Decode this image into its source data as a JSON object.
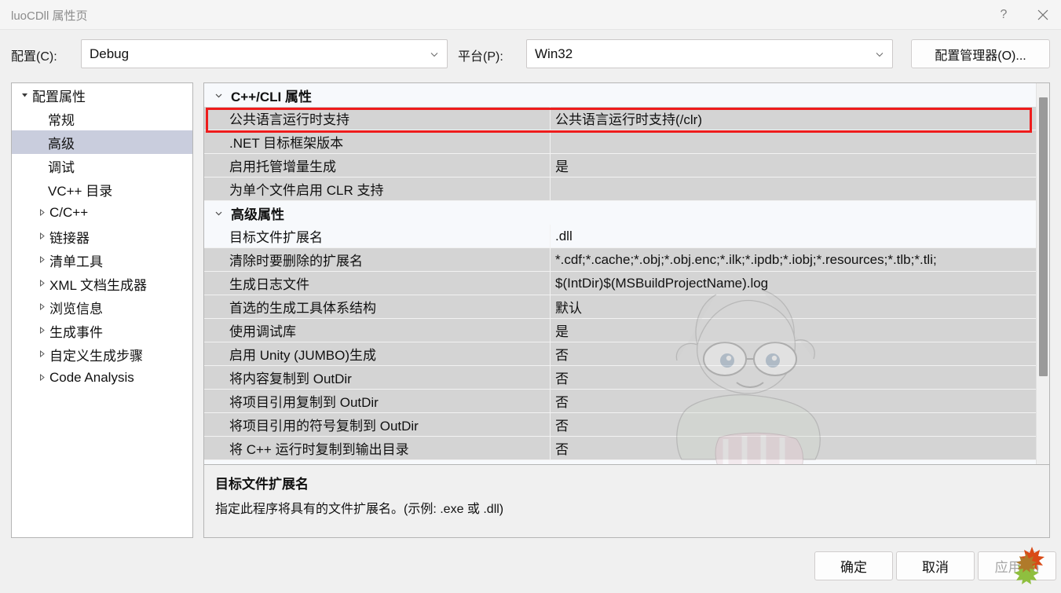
{
  "window": {
    "title": "luoCDll 属性页",
    "help_icon": "question-mark-icon",
    "close_icon": "close-icon"
  },
  "toolbar": {
    "config_label": "配置(C):",
    "config_value": "Debug",
    "platform_label": "平台(P):",
    "platform_value": "Win32",
    "config_manager_label": "配置管理器(O)...",
    "dropdown_icon": "chevron-down-icon"
  },
  "tree": {
    "items": [
      {
        "label": "配置属性",
        "level": 0,
        "expander": "triangle-down",
        "selected": false
      },
      {
        "label": "常规",
        "level": 1,
        "expander": "",
        "selected": false
      },
      {
        "label": "高级",
        "level": 1,
        "expander": "",
        "selected": true
      },
      {
        "label": "调试",
        "level": 1,
        "expander": "",
        "selected": false
      },
      {
        "label": "VC++ 目录",
        "level": 1,
        "expander": "",
        "selected": false
      },
      {
        "label": "C/C++",
        "level": 1,
        "expander": "triangle-right",
        "selected": false
      },
      {
        "label": "链接器",
        "level": 1,
        "expander": "triangle-right",
        "selected": false
      },
      {
        "label": "清单工具",
        "level": 1,
        "expander": "triangle-right",
        "selected": false
      },
      {
        "label": "XML 文档生成器",
        "level": 1,
        "expander": "triangle-right",
        "selected": false
      },
      {
        "label": "浏览信息",
        "level": 1,
        "expander": "triangle-right",
        "selected": false
      },
      {
        "label": "生成事件",
        "level": 1,
        "expander": "triangle-right",
        "selected": false
      },
      {
        "label": "自定义生成步骤",
        "level": 1,
        "expander": "triangle-right",
        "selected": false
      },
      {
        "label": "Code Analysis",
        "level": 1,
        "expander": "triangle-right",
        "selected": false
      }
    ]
  },
  "grid": {
    "sections": [
      {
        "title": "C++/CLI 属性",
        "collapse_icon": "chevron-down-icon",
        "rows": [
          {
            "name": "公共语言运行时支持",
            "value": "公共语言运行时支持(/clr)",
            "highlighted": true
          },
          {
            "name": ".NET 目标框架版本",
            "value": "",
            "highlighted": false
          },
          {
            "name": "启用托管增量生成",
            "value": "是",
            "highlighted": false
          },
          {
            "name": "为单个文件启用 CLR 支持",
            "value": "",
            "highlighted": false
          }
        ]
      },
      {
        "title": "高级属性",
        "collapse_icon": "chevron-down-icon",
        "rows": [
          {
            "name": "目标文件扩展名",
            "value": ".dll",
            "highlighted": false
          },
          {
            "name": "清除时要删除的扩展名",
            "value": "*.cdf;*.cache;*.obj;*.obj.enc;*.ilk;*.ipdb;*.iobj;*.resources;*.tlb;*.tli;",
            "highlighted": false
          },
          {
            "name": "生成日志文件",
            "value": "$(IntDir)$(MSBuildProjectName).log",
            "highlighted": false
          },
          {
            "name": "首选的生成工具体系结构",
            "value": "默认",
            "highlighted": false
          },
          {
            "name": "使用调试库",
            "value": "是",
            "highlighted": false
          },
          {
            "name": "启用 Unity (JUMBO)生成",
            "value": "否",
            "highlighted": false
          },
          {
            "name": "将内容复制到 OutDir",
            "value": "否",
            "highlighted": false
          },
          {
            "name": "将项目引用复制到 OutDir",
            "value": "否",
            "highlighted": false
          },
          {
            "name": "将项目引用的符号复制到 OutDir",
            "value": "否",
            "highlighted": false
          },
          {
            "name": "将 C++ 运行时复制到输出目录",
            "value": "否",
            "highlighted": false
          }
        ]
      }
    ],
    "highlight_color": "#ee1c1c",
    "scrollbar": "vertical-scrollbar"
  },
  "description": {
    "title": "目标文件扩展名",
    "text": "指定此程序将具有的文件扩展名。(示例: .exe 或 .dll)"
  },
  "buttons": {
    "ok": "确定",
    "cancel": "取消",
    "apply": "应用(A)"
  }
}
